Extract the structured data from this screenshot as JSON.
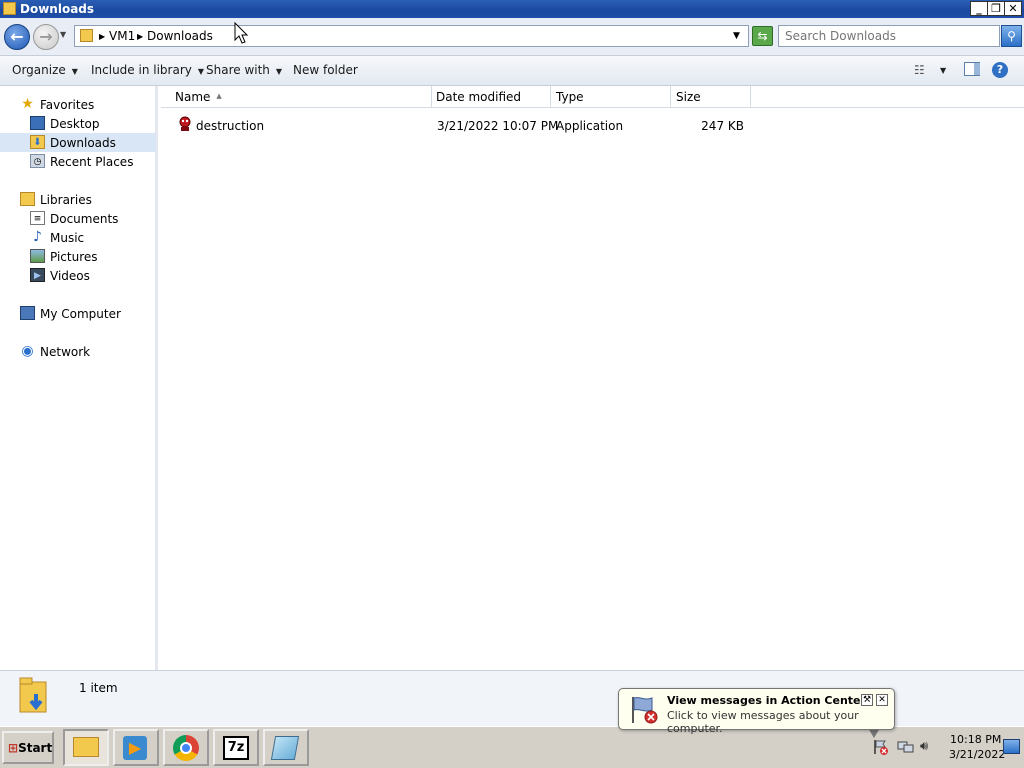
{
  "window": {
    "title": "Downloads"
  },
  "address_bar": {
    "crumbs": [
      "VM1",
      "Downloads"
    ],
    "search_placeholder": "Search Downloads"
  },
  "toolbar": {
    "organize": "Organize",
    "include_in_library": "Include in library",
    "share_with": "Share with",
    "new_folder": "New folder"
  },
  "nav_pane": {
    "favorites": {
      "label": "Favorites",
      "items": [
        {
          "label": "Desktop",
          "icon": "desktop-icon"
        },
        {
          "label": "Downloads",
          "icon": "downloads-folder-icon",
          "selected": true
        },
        {
          "label": "Recent Places",
          "icon": "recent-places-icon"
        }
      ]
    },
    "libraries": {
      "label": "Libraries",
      "items": [
        {
          "label": "Documents",
          "icon": "documents-icon"
        },
        {
          "label": "Music",
          "icon": "music-icon"
        },
        {
          "label": "Pictures",
          "icon": "pictures-icon"
        },
        {
          "label": "Videos",
          "icon": "videos-icon"
        }
      ]
    },
    "computer": {
      "label": "My Computer",
      "icon": "computer-icon"
    },
    "network": {
      "label": "Network",
      "icon": "network-icon"
    }
  },
  "file_list": {
    "columns": [
      "Name",
      "Date modified",
      "Type",
      "Size"
    ],
    "rows": [
      {
        "name": "destruction",
        "date_modified": "3/21/2022 10:07 PM",
        "type": "Application",
        "size": "247 KB",
        "icon": "application-icon"
      }
    ]
  },
  "status": {
    "count": "1 item"
  },
  "balloon": {
    "title": "View messages in Action Center",
    "text": "Click to view messages about your computer."
  },
  "taskbar": {
    "start": "Start",
    "apps": [
      "explorer-icon",
      "media-player-icon",
      "chrome-icon",
      "7zip-icon",
      "notepad-icon"
    ],
    "seven_zip_label": "7z",
    "clock_time": "10:18 PM",
    "clock_date": "3/21/2022"
  },
  "colors": {
    "titlebar": "#1f4fa8",
    "selection": "#d9e6f5",
    "taskbar": "#d4d0c8"
  }
}
